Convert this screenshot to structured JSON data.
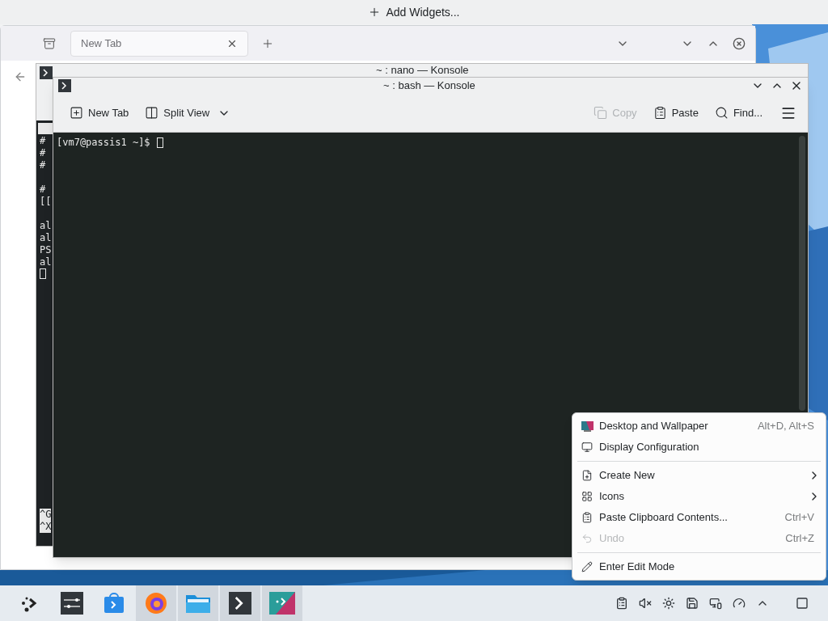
{
  "desktop_toolbar": {
    "label": "Add Widgets..."
  },
  "browser": {
    "tab": {
      "label": "New Tab"
    }
  },
  "background_konsole": {
    "title": "~ : nano — Konsole",
    "lines": [
      {
        "kind": "text",
        "text": "#"
      },
      {
        "kind": "text",
        "text": "#"
      },
      {
        "kind": "text",
        "text": "#"
      },
      {
        "kind": "blank"
      },
      {
        "kind": "text",
        "text": "#"
      },
      {
        "kind": "text",
        "text": "[["
      },
      {
        "kind": "blank"
      },
      {
        "kind": "text",
        "text": "al"
      },
      {
        "kind": "text",
        "text": "al"
      },
      {
        "kind": "text",
        "text": "PS"
      },
      {
        "kind": "text",
        "text": "al"
      }
    ],
    "shortcuts": [
      "^G",
      "^X"
    ]
  },
  "konsole": {
    "title": "~ : bash — Konsole",
    "toolbar": [
      {
        "kind": "new-tab",
        "label": "New Tab",
        "disabled": false
      },
      {
        "kind": "split",
        "label": "Split View",
        "disabled": false
      },
      {
        "kind": "copy",
        "label": "Copy",
        "disabled": true
      },
      {
        "kind": "paste",
        "label": "Paste",
        "disabled": false
      },
      {
        "kind": "find",
        "label": "Find...",
        "disabled": false
      }
    ],
    "prompt": "[vm7@passis1 ~]$"
  },
  "context_menu": [
    {
      "kind": "item",
      "label": "Desktop and Wallpaper",
      "shortcut": "Alt+D, Alt+S",
      "submenu": false,
      "disabled": false
    },
    {
      "kind": "item",
      "label": "Display Configuration",
      "submenu": false,
      "disabled": false
    },
    {
      "kind": "separator"
    },
    {
      "kind": "item",
      "label": "Create New",
      "submenu": true,
      "disabled": false
    },
    {
      "kind": "item",
      "label": "Icons",
      "submenu": true,
      "disabled": false
    },
    {
      "kind": "item",
      "label": "Paste Clipboard Contents...",
      "shortcut": "Ctrl+V",
      "submenu": false,
      "disabled": false
    },
    {
      "kind": "item",
      "label": "Undo",
      "shortcut": "Ctrl+Z",
      "submenu": false,
      "disabled": true
    },
    {
      "kind": "separator"
    },
    {
      "kind": "item",
      "label": "Enter Edit Mode",
      "submenu": false,
      "disabled": false
    }
  ],
  "taskbar": [
    {
      "kind": "launcher",
      "selected": false
    },
    {
      "kind": "settings",
      "selected": false
    },
    {
      "kind": "store",
      "selected": false
    },
    {
      "kind": "browser",
      "selected": true
    },
    {
      "kind": "files",
      "selected": true
    },
    {
      "kind": "terminal",
      "selected": true
    },
    {
      "kind": "tool",
      "selected": true
    }
  ]
}
